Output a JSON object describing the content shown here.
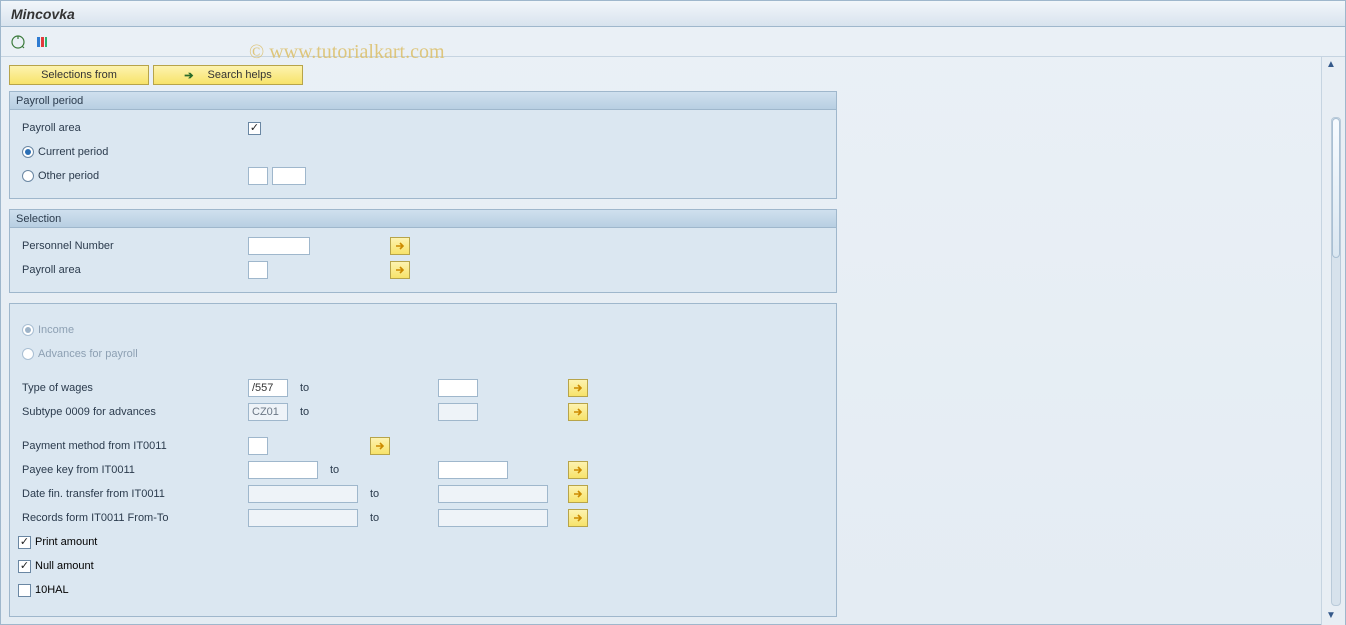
{
  "title": "Mincovka",
  "watermark": "© www.tutorialkart.com",
  "toolbar": {
    "selections_from": "Selections from",
    "search_helps": "Search helps"
  },
  "groups": {
    "payroll_period": {
      "title": "Payroll period",
      "payroll_area": "Payroll area",
      "current_period": "Current period",
      "other_period": "Other period"
    },
    "selection": {
      "title": "Selection",
      "personnel_number": "Personnel Number",
      "payroll_area": "Payroll area"
    }
  },
  "radios": {
    "income": "Income",
    "advances": "Advances for payroll"
  },
  "fields": {
    "type_of_wages": {
      "label": "Type of wages",
      "from": "/557",
      "to_label": "to",
      "to": ""
    },
    "subtype": {
      "label": "Subtype 0009 for advances",
      "from": "CZ01",
      "to_label": "to",
      "to": ""
    },
    "payment_method": {
      "label": "Payment method from IT0011",
      "value": ""
    },
    "payee_key": {
      "label": "Payee key from IT0011",
      "from": "",
      "to_label": "to",
      "to": ""
    },
    "date_fin": {
      "label": "Date fin. transfer from IT0011",
      "from": "",
      "to_label": "to",
      "to": ""
    },
    "records": {
      "label": "Records form IT0011 From-To",
      "from": "",
      "to_label": "to",
      "to": ""
    }
  },
  "checks": {
    "print_amount": "Print amount",
    "null_amount": "Null amount",
    "tenhal": "10HAL"
  }
}
